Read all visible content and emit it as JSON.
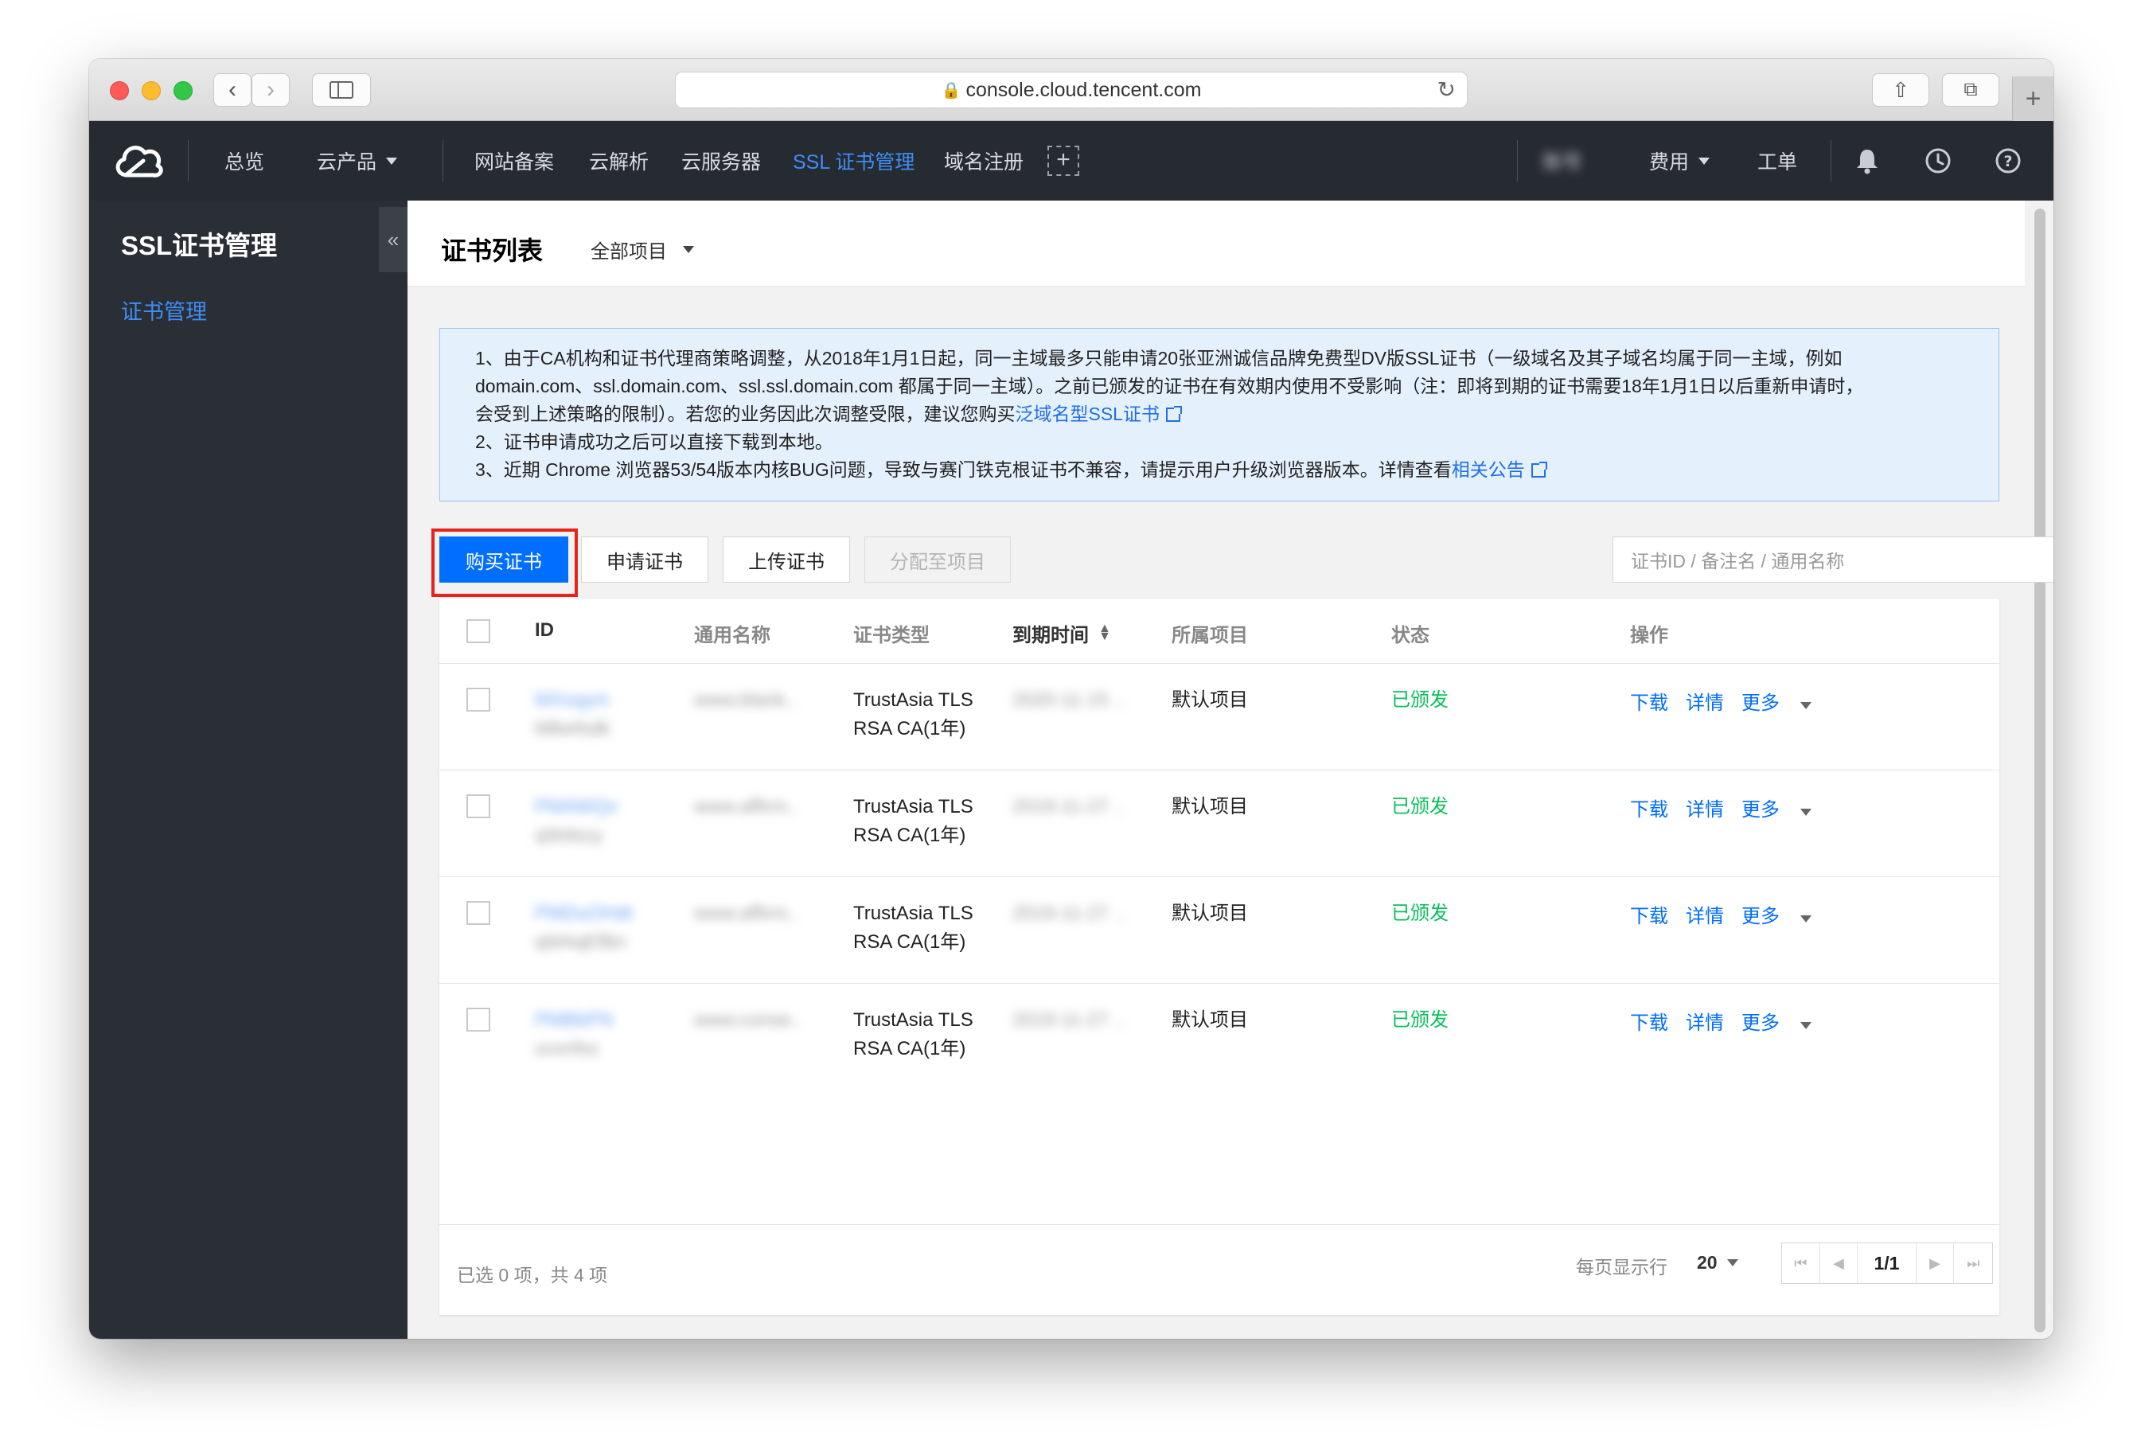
{
  "browser": {
    "url": "console.cloud.tencent.com"
  },
  "topnav": {
    "overview": "总览",
    "products": "云产品",
    "items": [
      "网站备案",
      "云解析",
      "云服务器",
      "SSL 证书管理",
      "域名注册"
    ],
    "account": "账号",
    "billing": "费用",
    "ticket": "工单"
  },
  "sidebar": {
    "title": "SSL证书管理",
    "item": "证书管理"
  },
  "page": {
    "title": "证书列表",
    "project_filter": "全部项目"
  },
  "notice": {
    "line1a": "1、由于CA机构和证书代理商策略调整，从2018年1月1日起，同一主域最多只能申请20张亚洲诚信品牌免费型DV版SSL证书（一级域名及其子域名均属于同一主域，例如",
    "line1b": "domain.com、ssl.domain.com、ssl.ssl.domain.com 都属于同一主域）。之前已颁发的证书在有效期内使用不受影响（注：即将到期的证书需要18年1月1日以后重新申请时，",
    "line1c": "会受到上述策略的限制）。若您的业务因此次调整受限，建议您购买",
    "link1": "泛域名型SSL证书",
    "line2": "2、证书申请成功之后可以直接下载到本地。",
    "line3": "3、近期 Chrome 浏览器53/54版本内核BUG问题，导致与赛门铁克根证书不兼容，请提示用户升级浏览器版本。详情查看",
    "link2": "相关公告"
  },
  "toolbar": {
    "buy": "购买证书",
    "apply": "申请证书",
    "upload": "上传证书",
    "assign": "分配至项目",
    "search_placeholder": "证书ID / 备注名 / 通用名称"
  },
  "table": {
    "headers": {
      "id": "ID",
      "name": "通用名称",
      "type": "证书类型",
      "expiry": "到期时间",
      "project": "所属项目",
      "status": "状态",
      "ops": "操作"
    },
    "rows": [
      {
        "id": "MXxqym",
        "id2": "Mlkefsdk",
        "name": "www.blank..",
        "type1": "TrustAsia TLS",
        "type2": "RSA CA(1年)",
        "expiry": "2020-11-15 ..",
        "project": "默认项目",
        "status": "已颁发"
      },
      {
        "id": "PMAWQv",
        "id2": "qWdszy",
        "name": "www.affirm..",
        "type1": "TrustAsia TLS",
        "type2": "RSA CA(1年)",
        "expiry": "2019-11-27 ..",
        "project": "默认项目",
        "status": "已颁发"
      },
      {
        "id": "PMDuOHdt",
        "id2": "qMAqEfBn",
        "name": "www.affirm..",
        "type1": "TrustAsia TLS",
        "type2": "RSA CA(1年)",
        "expiry": "2019-11-27 ..",
        "project": "默认项目",
        "status": "已颁发"
      },
      {
        "id": "PMBbPN",
        "id2": "uvxnfsc",
        "name": "www.conse..",
        "type1": "TrustAsia TLS",
        "type2": "RSA CA(1年)",
        "expiry": "2019-11-27 ..",
        "project": "默认项目",
        "status": "已颁发"
      }
    ],
    "ops": {
      "download": "下载",
      "detail": "详情",
      "more": "更多"
    }
  },
  "footer": {
    "selected": "已选 0 项，共 4 项",
    "per_page_label": "每页显示行",
    "per_page": "20",
    "page": "1/1"
  }
}
